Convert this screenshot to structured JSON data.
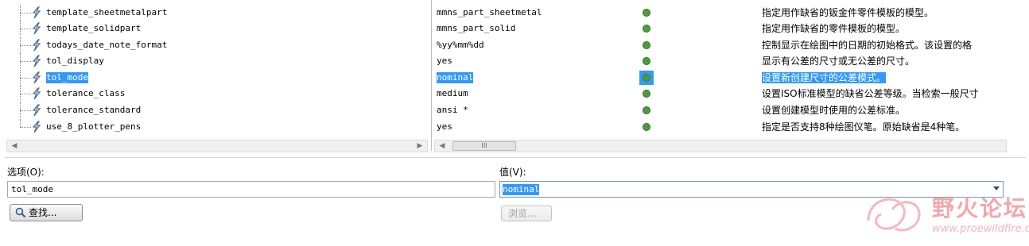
{
  "options_table": {
    "rows": [
      {
        "option": "template_sheetmetalpart",
        "value": "mmns_part_sheetmetal",
        "description": "指定用作缺省的钣金件零件模板的模型。"
      },
      {
        "option": "template_solidpart",
        "value": "mmns_part_solid",
        "description": "指定用作缺省的零件模板的模型。"
      },
      {
        "option": "todays_date_note_format",
        "value": "%yy%mm%dd",
        "description": "控制显示在绘图中的日期的初始格式。该设置的格"
      },
      {
        "option": "tol_display",
        "value": "yes",
        "description": "显示有公差的尺寸或无公差的尺寸。"
      },
      {
        "option": "tol_mode",
        "value": "nominal",
        "description": "设置新创建尺寸的公差模式。"
      },
      {
        "option": "tolerance_class",
        "value": "medium",
        "description": "设置ISO标准模型的缺省公差等级。当检索一般尺寸"
      },
      {
        "option": "tolerance_standard",
        "value": "ansi *",
        "description": "设置创建模型时使用的公差标准。"
      },
      {
        "option": "use_8_plotter_pens",
        "value": "yes",
        "description": "指定是否支持8种绘图仪笔。原始缺省是4种笔。"
      }
    ],
    "selected_index": 4,
    "scroll_thumb_glyph": "III"
  },
  "form": {
    "option_label": "选项(O):",
    "option_value": "tol_mode",
    "value_label": "值(V):",
    "value_value": "nominal",
    "find_button": "查找...",
    "browse_button": "浏览..."
  },
  "watermark": {
    "name": "野火论坛",
    "url": "www.proewildfire.cn"
  },
  "colors": {
    "selection": "#3399ff",
    "status_dot": "#4f9a3f",
    "watermark": "#f2a7ad"
  }
}
